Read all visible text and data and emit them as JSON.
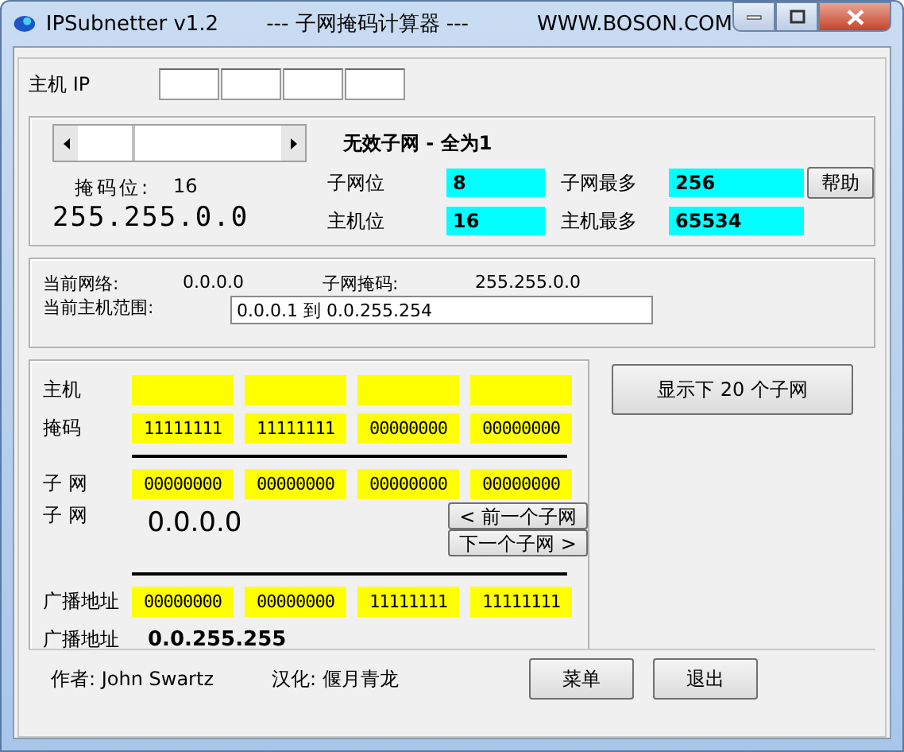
{
  "window": {
    "title": "IPSubnetter v1.2",
    "subtitle": "--- 子网掩码计算器 ---",
    "site": "WWW.BOSON.COM"
  },
  "host_ip": {
    "label": "主机 IP"
  },
  "mask": {
    "slider": {
      "level": 0.5
    },
    "bits_label": "掩码位:",
    "bits": "16",
    "mask": "255.255.0.0"
  },
  "subnet_info": {
    "heading": "无效子网 - 全为1",
    "rows": [
      {
        "label": "子网位",
        "value": "8",
        "max_label": "子网最多",
        "max_value": "256"
      },
      {
        "label": "主机位",
        "value": "16",
        "max_label": "主机最多",
        "max_value": "65534"
      }
    ],
    "help_button": "帮助"
  },
  "current": {
    "network_label": "当前网络:",
    "network": "0.0.0.0",
    "mask_label": "子网掩码:",
    "mask": "255.255.0.0",
    "range_label": "当前主机范围:",
    "range": "0.0.0.1  到 0.0.255.254"
  },
  "binary": {
    "host_label": "主机",
    "mask_label": "掩码",
    "mask": [
      "11111111",
      "11111111",
      "00000000",
      "00000000"
    ],
    "subnet_label": "子 网",
    "subnet": [
      "00000000",
      "00000000",
      "00000000",
      "00000000"
    ],
    "subnet_dec_label": "子 网",
    "subnet_dec": "0.0.0.0",
    "prev_button": "< 前一个子网",
    "next_button": "下一个子网 >",
    "broadcast_label": "广播地址",
    "broadcast": [
      "00000000",
      "00000000",
      "11111111",
      "11111111"
    ],
    "broadcast_dec_label": "广播地址",
    "broadcast_dec": "0.0.255.255"
  },
  "show_button": "显示下 20 个子网",
  "footer": {
    "author": "作者: John Swartz",
    "translator": "汉化: 偃月青龙",
    "buttons": [
      "菜单",
      "退出"
    ]
  }
}
